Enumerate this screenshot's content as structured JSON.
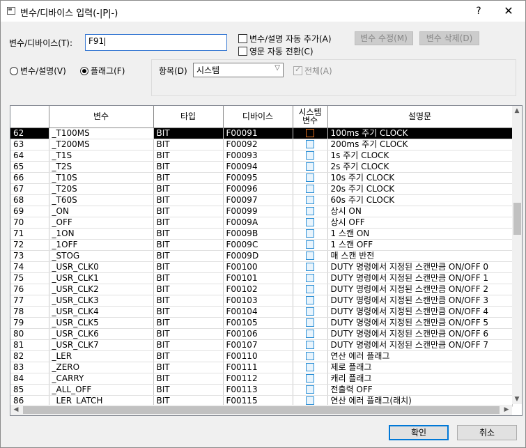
{
  "window": {
    "title": "변수/디바이스 입력(-|P|-)",
    "help_label": "?",
    "close_label": "✕"
  },
  "input": {
    "label": "변수/디바이스(T):",
    "value": "F91"
  },
  "options": {
    "auto_add_label": "변수/설명 자동 추가(A)",
    "auto_convert_label": "영문 자동 전환(C)",
    "modify_var_label": "변수 수정(M)",
    "delete_var_label": "변수 삭제(D)"
  },
  "mode": {
    "var_desc_label": "변수/설명(V)",
    "flag_label": "플래그(F)",
    "selected": "flag"
  },
  "filter": {
    "item_label": "항목(D)",
    "item_value": "시스템",
    "all_label": "전체(A)"
  },
  "table": {
    "headers": [
      "",
      "변수",
      "타입",
      "디바이스",
      "시스템\n변수",
      "설명문"
    ],
    "selected_row": "62",
    "rows": [
      {
        "num": "62",
        "var": "_T100MS",
        "type": "BIT",
        "device": "F00091",
        "desc": "100ms 주기 CLOCK"
      },
      {
        "num": "63",
        "var": "_T200MS",
        "type": "BIT",
        "device": "F00092",
        "desc": "200ms 주기 CLOCK"
      },
      {
        "num": "64",
        "var": "_T1S",
        "type": "BIT",
        "device": "F00093",
        "desc": "1s 주기 CLOCK"
      },
      {
        "num": "65",
        "var": "_T2S",
        "type": "BIT",
        "device": "F00094",
        "desc": "2s 주기 CLOCK"
      },
      {
        "num": "66",
        "var": "_T10S",
        "type": "BIT",
        "device": "F00095",
        "desc": "10s 주기 CLOCK"
      },
      {
        "num": "67",
        "var": "_T20S",
        "type": "BIT",
        "device": "F00096",
        "desc": "20s 주기 CLOCK"
      },
      {
        "num": "68",
        "var": "_T60S",
        "type": "BIT",
        "device": "F00097",
        "desc": "60s 주기 CLOCK"
      },
      {
        "num": "69",
        "var": "_ON",
        "type": "BIT",
        "device": "F00099",
        "desc": "상시 ON"
      },
      {
        "num": "70",
        "var": "_OFF",
        "type": "BIT",
        "device": "F0009A",
        "desc": "상시 OFF"
      },
      {
        "num": "71",
        "var": "_1ON",
        "type": "BIT",
        "device": "F0009B",
        "desc": "1 스캔 ON"
      },
      {
        "num": "72",
        "var": "_1OFF",
        "type": "BIT",
        "device": "F0009C",
        "desc": "1 스캔 OFF"
      },
      {
        "num": "73",
        "var": "_STOG",
        "type": "BIT",
        "device": "F0009D",
        "desc": "매 스캔 반전"
      },
      {
        "num": "74",
        "var": "_USR_CLK0",
        "type": "BIT",
        "device": "F00100",
        "desc": "DUTY 명령에서 지정된 스캔만큼 ON/OFF 0"
      },
      {
        "num": "75",
        "var": "_USR_CLK1",
        "type": "BIT",
        "device": "F00101",
        "desc": "DUTY 명령에서 지정된 스캔만큼 ON/OFF 1"
      },
      {
        "num": "76",
        "var": "_USR_CLK2",
        "type": "BIT",
        "device": "F00102",
        "desc": "DUTY 명령에서 지정된 스캔만큼 ON/OFF 2"
      },
      {
        "num": "77",
        "var": "_USR_CLK3",
        "type": "BIT",
        "device": "F00103",
        "desc": "DUTY 명령에서 지정된 스캔만큼 ON/OFF 3"
      },
      {
        "num": "78",
        "var": "_USR_CLK4",
        "type": "BIT",
        "device": "F00104",
        "desc": "DUTY 명령에서 지정된 스캔만큼 ON/OFF 4"
      },
      {
        "num": "79",
        "var": "_USR_CLK5",
        "type": "BIT",
        "device": "F00105",
        "desc": "DUTY 명령에서 지정된 스캔만큼 ON/OFF 5"
      },
      {
        "num": "80",
        "var": "_USR_CLK6",
        "type": "BIT",
        "device": "F00106",
        "desc": "DUTY 명령에서 지정된 스캔만큼 ON/OFF 6"
      },
      {
        "num": "81",
        "var": "_USR_CLK7",
        "type": "BIT",
        "device": "F00107",
        "desc": "DUTY 명령에서 지정된 스캔만큼 ON/OFF 7"
      },
      {
        "num": "82",
        "var": "_LER",
        "type": "BIT",
        "device": "F00110",
        "desc": "연산 에러 플래그"
      },
      {
        "num": "83",
        "var": "_ZERO",
        "type": "BIT",
        "device": "F00111",
        "desc": "제로 플래그"
      },
      {
        "num": "84",
        "var": "_CARRY",
        "type": "BIT",
        "device": "F00112",
        "desc": "캐리 플래그"
      },
      {
        "num": "85",
        "var": "_ALL_OFF",
        "type": "BIT",
        "device": "F00113",
        "desc": "전출력 OFF"
      },
      {
        "num": "86",
        "var": "_LER_LATCH",
        "type": "BIT",
        "device": "F00115",
        "desc": "연산 에러 플래그(래치)"
      }
    ]
  },
  "footer": {
    "ok_label": "확인",
    "cancel_label": "취소"
  },
  "colors": {
    "accent": "#0078d7",
    "selected_row_bg": "#000000",
    "sys_checkbox": "#2a8fd6",
    "sys_checkbox_selected": "#d86a1c"
  }
}
